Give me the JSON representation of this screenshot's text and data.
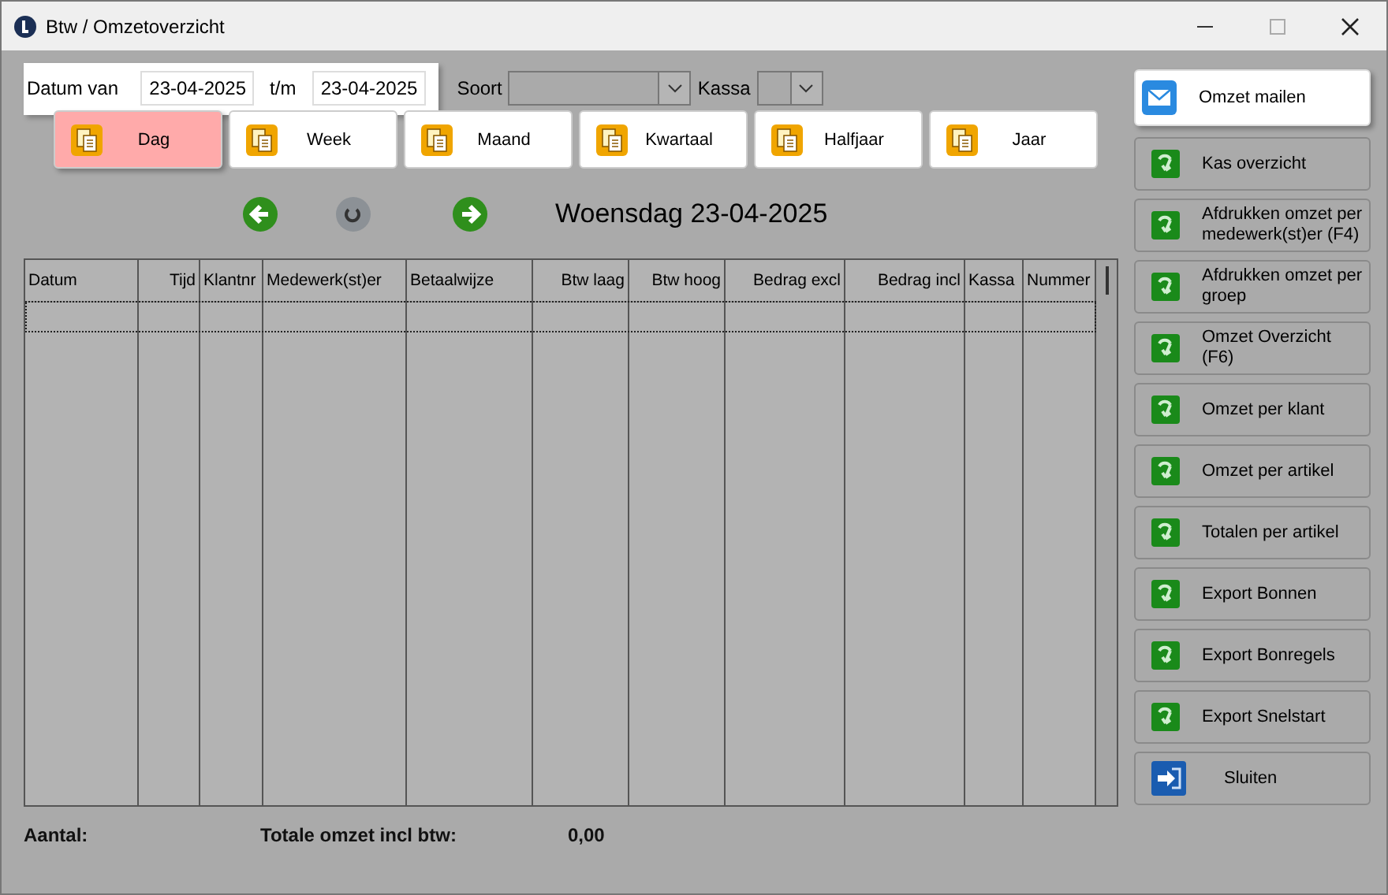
{
  "window": {
    "title": "Btw / Omzetoverzicht"
  },
  "filters": {
    "date_from_label": "Datum van",
    "date_from": "23-04-2025",
    "date_to_label": "t/m",
    "date_to": "23-04-2025",
    "soort_label": "Soort",
    "kassa_label": "Kassa"
  },
  "periods": [
    {
      "label": "Dag",
      "selected": true
    },
    {
      "label": "Week",
      "selected": false
    },
    {
      "label": "Maand",
      "selected": false
    },
    {
      "label": "Kwartaal",
      "selected": false
    },
    {
      "label": "Halfjaar",
      "selected": false
    },
    {
      "label": "Jaar",
      "selected": false
    }
  ],
  "navigation": {
    "date": "Woensdag 23-04-2025"
  },
  "table": {
    "columns": [
      {
        "label": "Datum"
      },
      {
        "label": "Tijd"
      },
      {
        "label": "Klantnr"
      },
      {
        "label": "Medewerk(st)er"
      },
      {
        "label": "Betaalwijze"
      },
      {
        "label": "Btw laag"
      },
      {
        "label": "Btw hoog"
      },
      {
        "label": "Bedrag excl"
      },
      {
        "label": "Bedrag incl"
      },
      {
        "label": "Kassa"
      },
      {
        "label": "Nummer"
      }
    ]
  },
  "footer": {
    "count_label": "Aantal:",
    "total_label": "Totale omzet incl btw:",
    "total_value": "0,00"
  },
  "actions": [
    {
      "label": "Omzet mailen",
      "kind": "mail"
    },
    {
      "label": "Kas overzicht",
      "kind": "report"
    },
    {
      "label": "Afdrukken omzet per medewerk(st)er (F4)",
      "kind": "report"
    },
    {
      "label": "Afdrukken omzet per groep",
      "kind": "report"
    },
    {
      "label": "Omzet Overzicht (F6)",
      "kind": "report"
    },
    {
      "label": "Omzet per klant",
      "kind": "report"
    },
    {
      "label": "Omzet per artikel",
      "kind": "report"
    },
    {
      "label": "Totalen per artikel",
      "kind": "report"
    },
    {
      "label": "Export Bonnen",
      "kind": "report"
    },
    {
      "label": "Export Bonregels",
      "kind": "report"
    },
    {
      "label": "Export Snelstart",
      "kind": "report"
    },
    {
      "label": "Sluiten",
      "kind": "exit"
    }
  ]
}
